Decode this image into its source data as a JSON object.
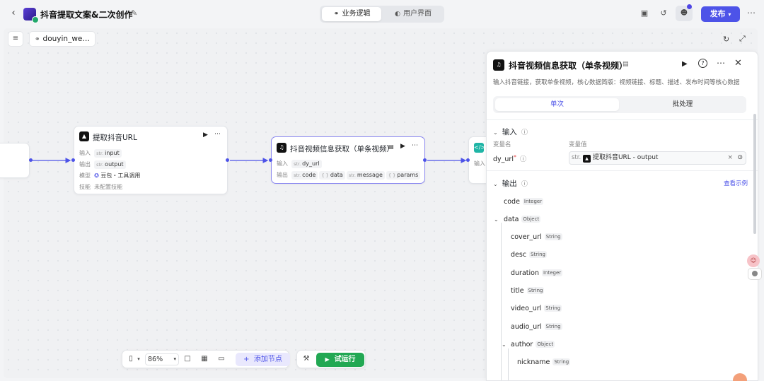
{
  "header": {
    "back_icon": "chevron-left-icon",
    "app_title": "抖音提取文案&二次创作",
    "tabs": [
      {
        "label": "业务逻辑",
        "icon": "flow-icon",
        "active": true
      },
      {
        "label": "用户界面",
        "icon": "palette-icon",
        "active": false
      }
    ],
    "publish_label": "发布",
    "accent_color": "#4d53e8"
  },
  "canvas": {
    "flow_name": "douyin_we…",
    "nodes": [
      {
        "title": "提取抖音URL",
        "input_label": "输入",
        "input_type": "str.",
        "input_value": "input",
        "output_label": "输出",
        "output_type": "str.",
        "output_value": "output",
        "model_label": "模型",
        "model_value": "豆包・工具调用",
        "skill_label": "技能",
        "skill_value": "未配置技能"
      },
      {
        "title": "抖音视频信息获取（单条视频）",
        "input_label": "输入",
        "input_type": "str.",
        "input_value": "dy_url",
        "output_label": "输出",
        "outputs": [
          {
            "type": "str.",
            "name": "code"
          },
          {
            "type": "{ }",
            "name": "data"
          },
          {
            "type": "str.",
            "name": "message"
          },
          {
            "type": "{ }",
            "name": "params"
          }
        ]
      },
      {
        "input_label": "输入"
      }
    ]
  },
  "toolbar": {
    "zoom": "86%",
    "add_node_label": "添加节点",
    "run_label": "试运行"
  },
  "panel": {
    "title": "抖音视频信息获取（单条视频）",
    "description": "输入抖音链接，获取单条视频，核心数据简版：视频链接、标题、描述、发布时间等核心数据",
    "tabs": [
      "单次",
      "批处理"
    ],
    "input_section": "输入",
    "col_name": "变量名",
    "col_value": "变量值",
    "var_name": "dy_url",
    "var_required": "*",
    "var_type": "str.",
    "ref_value": "提取抖音URL - output",
    "output_section": "输出",
    "see_example": "查看示例",
    "outputs": [
      {
        "name": "code",
        "type": "Integer"
      },
      {
        "name": "data",
        "type": "Object"
      },
      {
        "name": "cover_url",
        "type": "String"
      },
      {
        "name": "desc",
        "type": "String"
      },
      {
        "name": "duration",
        "type": "Integer"
      },
      {
        "name": "title",
        "type": "String"
      },
      {
        "name": "video_url",
        "type": "String"
      },
      {
        "name": "audio_url",
        "type": "String"
      },
      {
        "name": "author",
        "type": "Object"
      },
      {
        "name": "nickname",
        "type": "String"
      }
    ]
  }
}
